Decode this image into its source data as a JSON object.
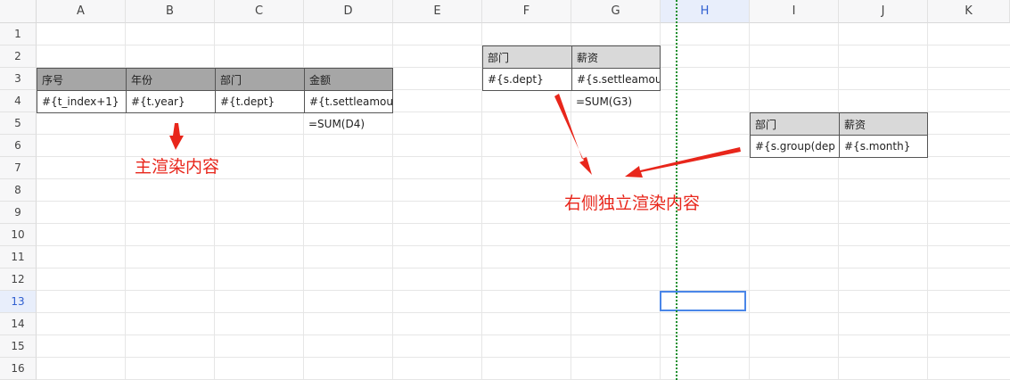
{
  "columns": [
    "A",
    "B",
    "C",
    "D",
    "E",
    "F",
    "G",
    "H",
    "I",
    "J",
    "K"
  ],
  "selected_column": "H",
  "rows": [
    "1",
    "2",
    "3",
    "4",
    "5",
    "6",
    "7",
    "8",
    "9",
    "10",
    "11",
    "12",
    "13",
    "14",
    "15",
    "16"
  ],
  "selected_row": "13",
  "main_table": {
    "headers": [
      "序号",
      "年份",
      "部门",
      "金额"
    ],
    "row": [
      "#{t_index+1}",
      "#{t.year}",
      "#{t.dept}",
      "#{t.settleamou"
    ],
    "sum": "=SUM(D4)"
  },
  "right_table": {
    "headers": [
      "部门",
      "薪资"
    ],
    "row": [
      "#{s.dept}",
      "#{s.settleamou"
    ],
    "sum": "=SUM(G3)"
  },
  "group_table": {
    "headers": [
      "部门",
      "薪资"
    ],
    "row": [
      "#{s.group(dep",
      "#{s.month}"
    ]
  },
  "annotations": {
    "main": "主渲染内容",
    "right": "右侧独立渲染内容"
  },
  "colors": {
    "annotation": "#e8261b",
    "page_break_line": "#1e8f2f",
    "selection": "#4a86e8"
  }
}
